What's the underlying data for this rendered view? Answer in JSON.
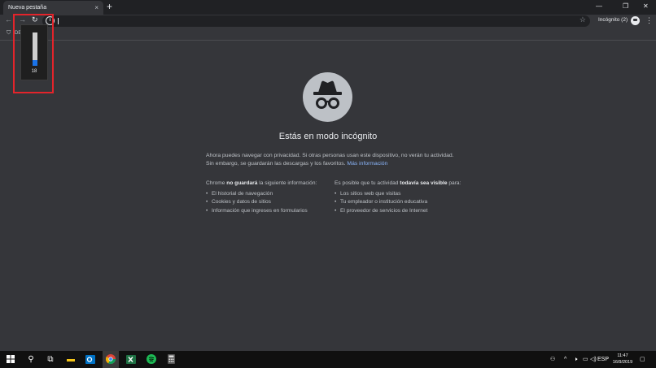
{
  "tab": {
    "title": "Nueva pestaña",
    "close_icon": "×",
    "new_tab_icon": "+"
  },
  "window_controls": {
    "minimize": "—",
    "restore": "❐",
    "close": "✕"
  },
  "toolbar": {
    "back_icon": "←",
    "forward_icon": "→",
    "reload_icon": "↻",
    "info_icon": "i",
    "star_icon": "☆",
    "incognito_label": "Incógnito (2)",
    "menu_icon": "⋮"
  },
  "bookmarks": {
    "item_label": "DE"
  },
  "volume": {
    "value": "18",
    "level": 0.18
  },
  "main": {
    "title": "Estás en modo incógnito",
    "intro_text": "Ahora puedes navegar con privacidad. Si otras personas usan este dispositivo, no verán tu actividad. Sin embargo, se guardarán las descargas y los favoritos.",
    "more_info_link": "Más información",
    "left_heading_prefix": "Chrome ",
    "left_heading_strong": "no guardará",
    "left_heading_suffix": " la siguiente información:",
    "left_items": [
      "El historial de navegación",
      "Cookies y datos de sitios",
      "Información que ingreses en formularios"
    ],
    "right_heading_prefix": "Es posible que tu actividad ",
    "right_heading_strong": "todavía sea visible",
    "right_heading_suffix": " para:",
    "right_items": [
      "Los sitios web que visitas",
      "Tu empleador o institución educativa",
      "El proveedor de servicios de Internet"
    ]
  },
  "taskbar": {
    "language": "ESP",
    "time": "11:47",
    "date": "16/9/2019"
  },
  "colors": {
    "highlight": "#e3242b",
    "accent": "#1a73e8",
    "link": "#8ab4f8"
  }
}
